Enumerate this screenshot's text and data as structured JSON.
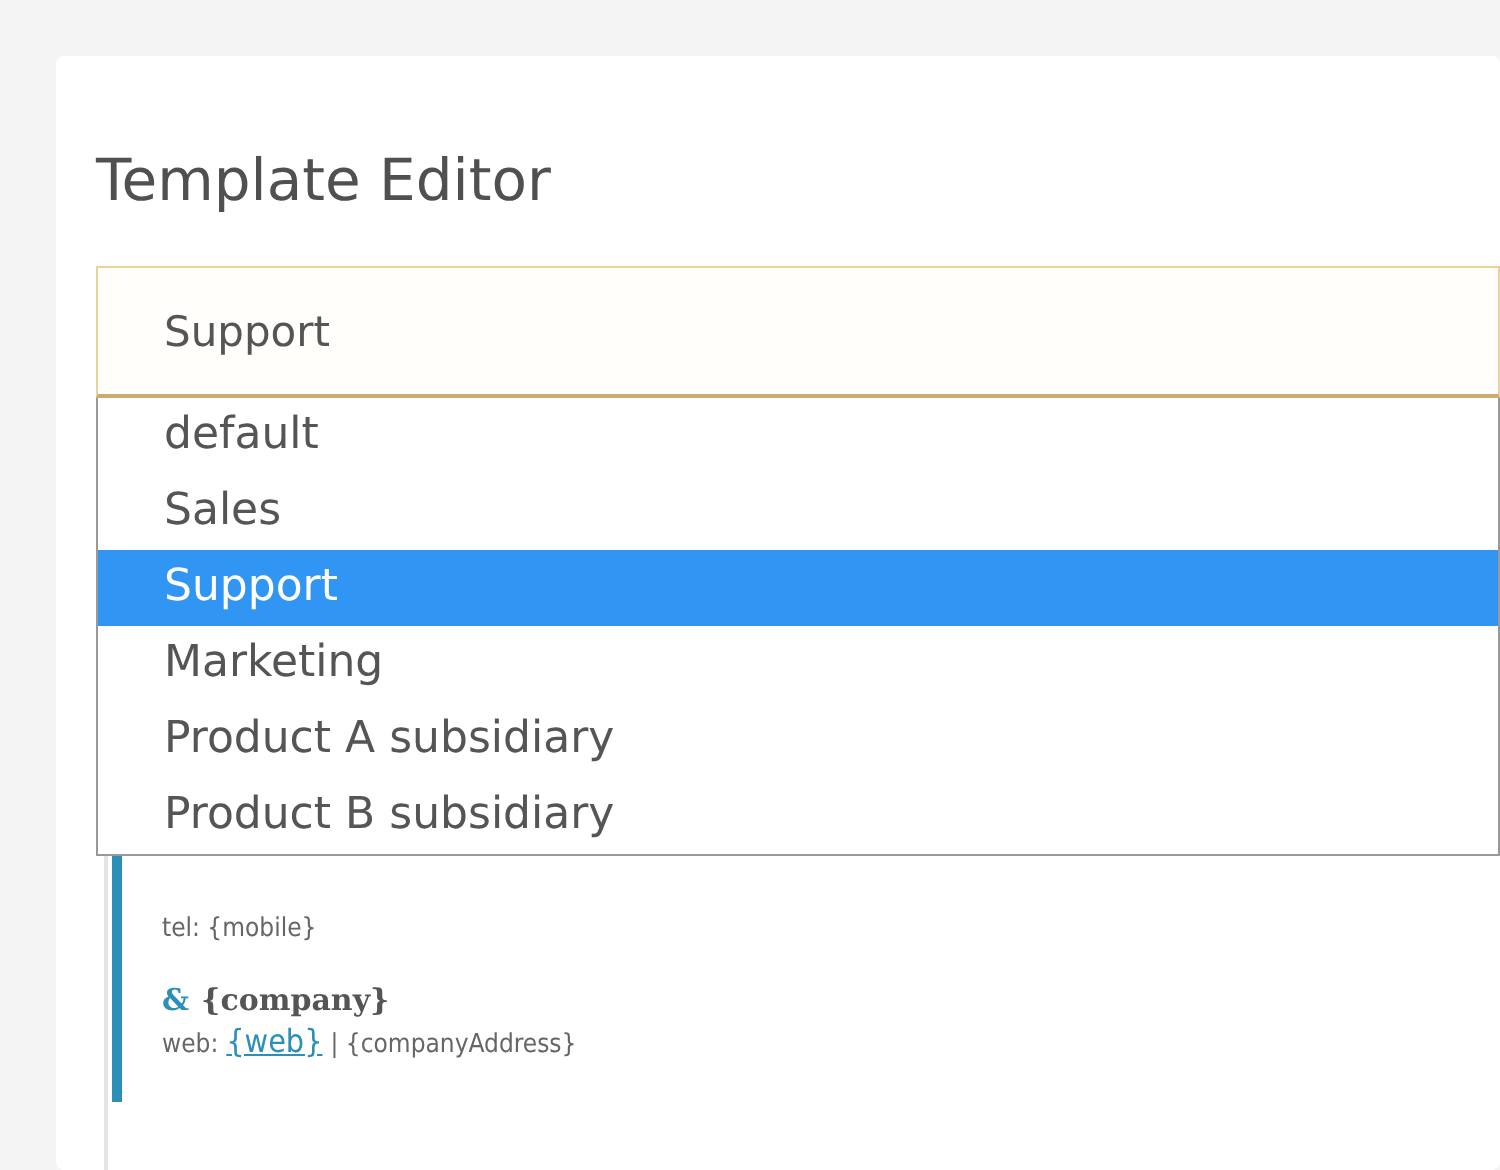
{
  "title": "Template Editor",
  "select": {
    "value": "Support"
  },
  "options": [
    {
      "label": "default",
      "selected": false
    },
    {
      "label": "Sales",
      "selected": false
    },
    {
      "label": "Support",
      "selected": true
    },
    {
      "label": "Marketing",
      "selected": false
    },
    {
      "label": "Product A subsidiary",
      "selected": false
    },
    {
      "label": "Product B subsidiary",
      "selected": false
    }
  ],
  "signature": {
    "phone_line": "tel: {mobile}",
    "company_prefix": "&",
    "company": "{company}",
    "web_label": "web:",
    "web_link": "{web}",
    "separator": "|",
    "address": "{companyAddress}"
  }
}
